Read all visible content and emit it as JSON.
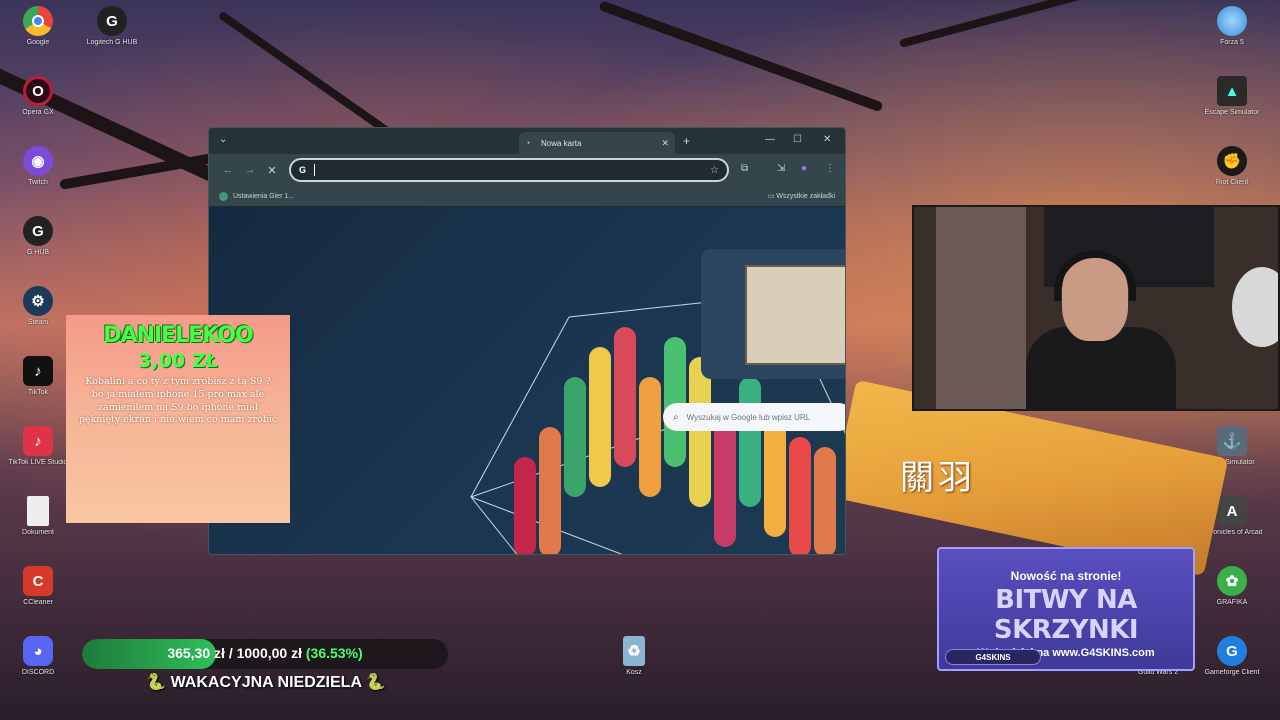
{
  "desktop_icons": {
    "left": [
      {
        "label": "Google",
        "icon": "chrome-icon",
        "color": "#e8453c"
      },
      {
        "label": "Logitech G HUB",
        "icon": "logitech-icon",
        "color": "#222222"
      },
      {
        "label": "Opera GX",
        "icon": "opera-icon",
        "color": "#c01b3a"
      },
      {
        "label": "Twitch",
        "icon": "twitch-icon",
        "color": "#7d4ad9"
      },
      {
        "label": "G HUB",
        "icon": "logitech-icon",
        "color": "#222222"
      },
      {
        "label": "Steam",
        "icon": "steam-icon",
        "color": "#1b3a5a"
      },
      {
        "label": "TikTok",
        "icon": "tiktok-icon",
        "color": "#111111"
      },
      {
        "label": "TikTok LIVE Studio",
        "icon": "tiktok-live-icon",
        "color": "#e0334a"
      },
      {
        "label": "Dokument",
        "icon": "file-icon",
        "color": "#eeeeee"
      },
      {
        "label": "CCleaner",
        "icon": "ccleaner-icon",
        "color": "#d83a2a"
      },
      {
        "label": "DISCORD",
        "icon": "discord-icon",
        "color": "#5865f2"
      }
    ],
    "right": [
      {
        "label": "Forza 5",
        "icon": "forza-icon",
        "color": "#3a8ad9"
      },
      {
        "label": "Escape Simulator",
        "icon": "game-icon",
        "color": "#2a2a2a"
      },
      {
        "label": "Riot Client",
        "icon": "riot-icon",
        "color": "#c0272d"
      },
      {
        "label": "Ship Simulator",
        "icon": "ship-icon",
        "color": "#5a6a7a"
      },
      {
        "label": "Chronicles of Arcadia",
        "icon": "arcadia-icon",
        "color": "#444444"
      },
      {
        "label": "GRAFIKA",
        "icon": "palette-icon",
        "color": "#3ab04a"
      },
      {
        "label": "Guild Wars 2",
        "icon": "gw2-icon",
        "color": "#aa2222"
      },
      {
        "label": "Gameforge Client",
        "icon": "gameforge-icon",
        "color": "#1f7fe0"
      }
    ],
    "recycle_bin": {
      "label": "Kosz",
      "icon": "recycle-bin-icon"
    }
  },
  "browser": {
    "tab_title": "Nowa karta",
    "bookmark": "Ustawienia Gier 1...",
    "all_bookmarks": "Wszystkie zakładki",
    "search_placeholder": "Wyszukaj w Google lub wpisz URL",
    "omnibox_value": ""
  },
  "donation": {
    "name": "DANIELEKOO",
    "amount": "3,00 ZŁ",
    "message": "Kobalini a co ty z tym zrobisz z tą S9 ? bo ja miałem iphone 15 pro max ale zamieniłem na S9 bo iphone miał pęknięty ekran i nie wiem co mam zrobić"
  },
  "weapon_text": "關羽",
  "ad": {
    "line1": "Nowość na stronie!",
    "line2": "BITWY NA SKRZYNKI",
    "line3": "Weź udział na www.G4SKINS.com",
    "brand": "G4SKINS"
  },
  "goal": {
    "current": "365,30 zł",
    "separator": "/",
    "target": "1000,00 zł",
    "percent_text": "(36.53%)",
    "percent": 36.53,
    "title": "WAKACYJNA NIEDZIELA",
    "emoji": "🐍"
  }
}
